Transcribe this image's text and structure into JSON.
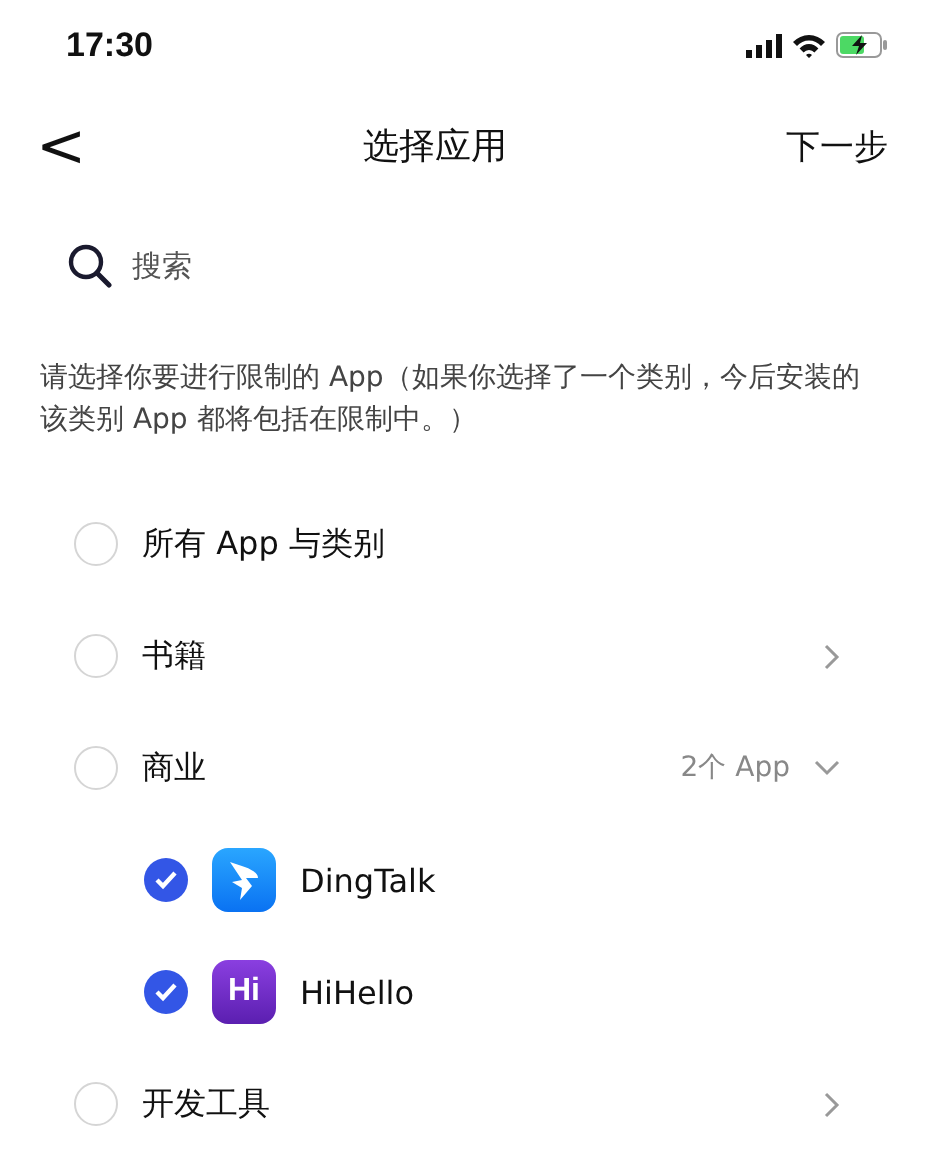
{
  "status_bar": {
    "time": "17:30",
    "charging": true
  },
  "nav": {
    "back": "<",
    "title": "选择应用",
    "next": "下一步"
  },
  "search": {
    "placeholder": "搜索"
  },
  "description": "请选择你要进行限制的 App（如果你选择了一个类别，今后安装的该类别 App 都将包括在限制中。）",
  "items": [
    {
      "kind": "category",
      "label": "所有 App 与类别",
      "checked": false
    },
    {
      "kind": "category",
      "label": "书籍",
      "checked": false,
      "expanded": false
    },
    {
      "kind": "category",
      "label": "商业",
      "checked": false,
      "expanded": true,
      "count": "2个 App",
      "children": [
        {
          "kind": "app",
          "label": "DingTalk",
          "checked": true
        },
        {
          "kind": "app",
          "label": "HiHello",
          "checked": true,
          "icon_text": "Hi"
        }
      ]
    },
    {
      "kind": "category",
      "label": "开发工具",
      "checked": false,
      "expanded": false
    }
  ]
}
